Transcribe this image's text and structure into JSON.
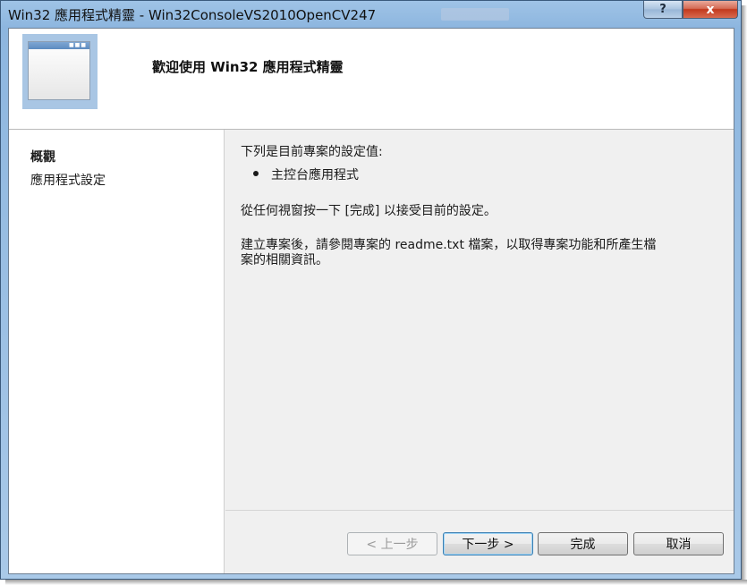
{
  "window": {
    "title": "Win32 應用程式精靈 - Win32ConsoleVS2010OpenCV247",
    "help_label": "?",
    "close_label": "x"
  },
  "header": {
    "title": "歡迎使用 Win32 應用程式精靈"
  },
  "sidebar": {
    "items": [
      {
        "label": "概觀",
        "selected": true
      },
      {
        "label": "應用程式設定",
        "selected": false
      }
    ]
  },
  "content": {
    "intro": "下列是目前專案的設定值:",
    "bullets": [
      "主控台應用程式"
    ],
    "finish_hint": "從任何視窗按一下 [完成] 以接受目前的設定。",
    "readme_line1": "建立專案後，請參閱專案的 readme.txt 檔案，以取得專案功能和所產生檔",
    "readme_line2": "案的相關資訊。"
  },
  "buttons": {
    "back": "< 上一步",
    "next": "下一步 >",
    "finish": "完成",
    "cancel": "取消"
  },
  "colors": {
    "titlebar": "#9fc3e6",
    "close_button": "#c2391d",
    "client_background": "#f0f0f0",
    "default_button_border": "#3c7fb1"
  }
}
